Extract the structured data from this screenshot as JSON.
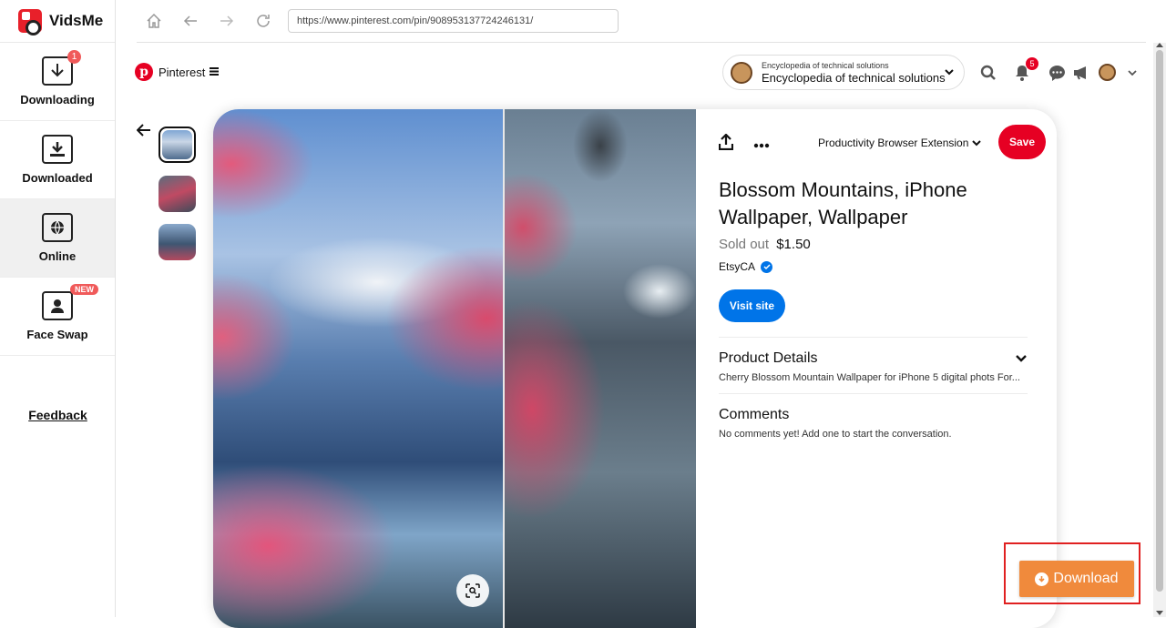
{
  "app": {
    "name": "VidsMe"
  },
  "sidebar": {
    "items": [
      {
        "label": "Downloading",
        "badge": "1"
      },
      {
        "label": "Downloaded"
      },
      {
        "label": "Online"
      },
      {
        "label": "Face Swap",
        "badge": "NEW"
      }
    ],
    "feedback": "Feedback"
  },
  "browser": {
    "url": "https://www.pinterest.com/pin/908953137724246131/"
  },
  "pinterest": {
    "site_name": "Pinterest",
    "account": {
      "small": "Encyclopedia of technical solutions",
      "name": "Encyclopedia of technical solutions"
    },
    "notification_count": "5"
  },
  "pin": {
    "board": "Productivity Browser Extension",
    "save_label": "Save",
    "title": "Blossom Mountains, iPhone Wallpaper, Wallpaper",
    "sold_out": "Sold out",
    "price": "$1.50",
    "seller": "EtsyCA",
    "visit_label": "Visit site",
    "details_title": "Product Details",
    "details_desc": "Cherry Blossom Mountain Wallpaper for iPhone 5 digital phots For...",
    "comments_title": "Comments",
    "comments_text": "No comments yet! Add one to start the conversation."
  },
  "download": {
    "label": "Download"
  },
  "colors": {
    "pinterest_red": "#e60023",
    "visit_blue": "#0074e8",
    "download_orange": "#f08a3c",
    "highlight_red": "#e02020"
  }
}
